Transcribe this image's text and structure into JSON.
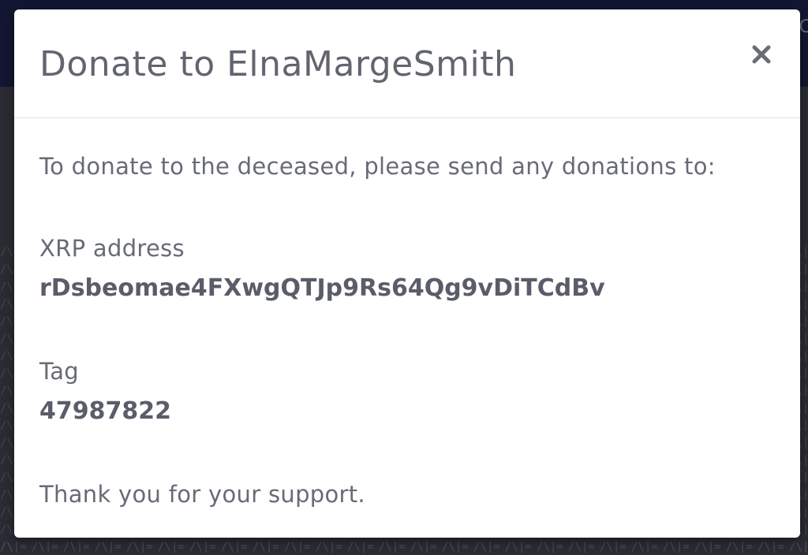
{
  "modal": {
    "title": "Donate to ElnaMargeSmith",
    "close_icon": "close-icon",
    "intro": "To donate to the deceased, please send any donations to:",
    "xrp": {
      "label": "XRP address",
      "value": "rDsbeomae4FXwgQTJp9Rs64Qg9vDiTCdBv"
    },
    "tag": {
      "label": "Tag",
      "value": "47987822"
    },
    "thanks": "Thank you for your support."
  },
  "colors": {
    "backdrop_top": "#121632",
    "backdrop_bottom": "#2a2c33",
    "modal_bg": "#ffffff",
    "text_muted": "#686b76",
    "text_strong": "#5a5d69"
  }
}
